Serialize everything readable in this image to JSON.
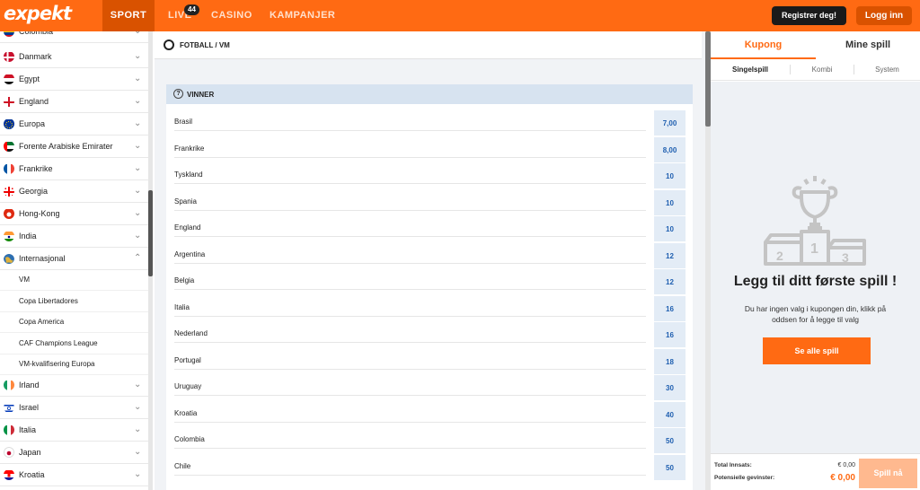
{
  "header": {
    "logo": "expekt",
    "nav": [
      {
        "label": "SPORT"
      },
      {
        "label": "LIVE",
        "badge": "44"
      },
      {
        "label": "CASINO"
      },
      {
        "label": "KAMPANJER"
      }
    ],
    "register_label": "Registrer deg!",
    "login_label": "Logg inn",
    "accent_color": "#ff6a13"
  },
  "sidebar": {
    "countries": [
      {
        "name": "Colombia",
        "icon": "flag-colombia-icon",
        "chevron": "chevron-down-icon"
      },
      {
        "name": "Danmark",
        "icon": "flag-denmark-icon",
        "chevron": "chevron-down-icon"
      },
      {
        "name": "Egypt",
        "icon": "flag-egypt-icon",
        "chevron": "chevron-down-icon"
      },
      {
        "name": "England",
        "icon": "flag-england-icon",
        "chevron": "chevron-down-icon"
      },
      {
        "name": "Europa",
        "icon": "flag-europe-icon",
        "chevron": "chevron-down-icon"
      },
      {
        "name": "Forente Arabiske Emirater",
        "icon": "flag-uae-icon",
        "chevron": "chevron-down-icon"
      },
      {
        "name": "Frankrike",
        "icon": "flag-france-icon",
        "chevron": "chevron-down-icon"
      },
      {
        "name": "Georgia",
        "icon": "flag-georgia-icon",
        "chevron": "chevron-down-icon"
      },
      {
        "name": "Hong-Kong",
        "icon": "flag-hongkong-icon",
        "chevron": "chevron-down-icon"
      },
      {
        "name": "India",
        "icon": "flag-india-icon",
        "chevron": "chevron-down-icon"
      },
      {
        "name": "Internasjonal",
        "icon": "globe-icon",
        "chevron": "chevron-up-icon",
        "expanded": true
      }
    ],
    "sub_items": [
      "VM",
      "Copa Libertadores",
      "Copa America",
      "CAF Champions League",
      "VM-kvalifisering Europa"
    ],
    "countries_after": [
      {
        "name": "Irland",
        "icon": "flag-ireland-icon",
        "chevron": "chevron-down-icon"
      },
      {
        "name": "Israel",
        "icon": "flag-israel-icon",
        "chevron": "chevron-down-icon"
      },
      {
        "name": "Italia",
        "icon": "flag-italy-icon",
        "chevron": "chevron-down-icon"
      },
      {
        "name": "Japan",
        "icon": "flag-japan-icon",
        "chevron": "chevron-down-icon"
      },
      {
        "name": "Kroatia",
        "icon": "flag-croatia-icon",
        "chevron": "chevron-down-icon"
      }
    ]
  },
  "main": {
    "breadcrumb": "FOTBALL / VM",
    "market_title": "VINNER",
    "selections": [
      {
        "name": "Brasil",
        "odds": "7,00"
      },
      {
        "name": "Frankrike",
        "odds": "8,00"
      },
      {
        "name": "Tyskland",
        "odds": "10"
      },
      {
        "name": "Spania",
        "odds": "10"
      },
      {
        "name": "England",
        "odds": "10"
      },
      {
        "name": "Argentina",
        "odds": "12"
      },
      {
        "name": "Belgia",
        "odds": "12"
      },
      {
        "name": "Italia",
        "odds": "16"
      },
      {
        "name": "Nederland",
        "odds": "16"
      },
      {
        "name": "Portugal",
        "odds": "18"
      },
      {
        "name": "Uruguay",
        "odds": "30"
      },
      {
        "name": "Kroatia",
        "odds": "40"
      },
      {
        "name": "Colombia",
        "odds": "50"
      },
      {
        "name": "Chile",
        "odds": "50"
      }
    ]
  },
  "coupon": {
    "tabs": [
      "Kupong",
      "Mine spill"
    ],
    "subtabs": [
      "Singelspill",
      "Kombi",
      "System"
    ],
    "empty_title": "Legg til ditt første spill !",
    "empty_desc": "Du har ingen valg i kupongen din, klikk på oddsen for å legge til valg",
    "see_all_label": "Se alle spill",
    "total_stake_label": "Total Innsats:",
    "total_stake_value": "€ 0,00",
    "potential_win_label": "Potensielle gevinster:",
    "potential_win_value": "€ 0,00",
    "play_label": "Spill nå"
  }
}
